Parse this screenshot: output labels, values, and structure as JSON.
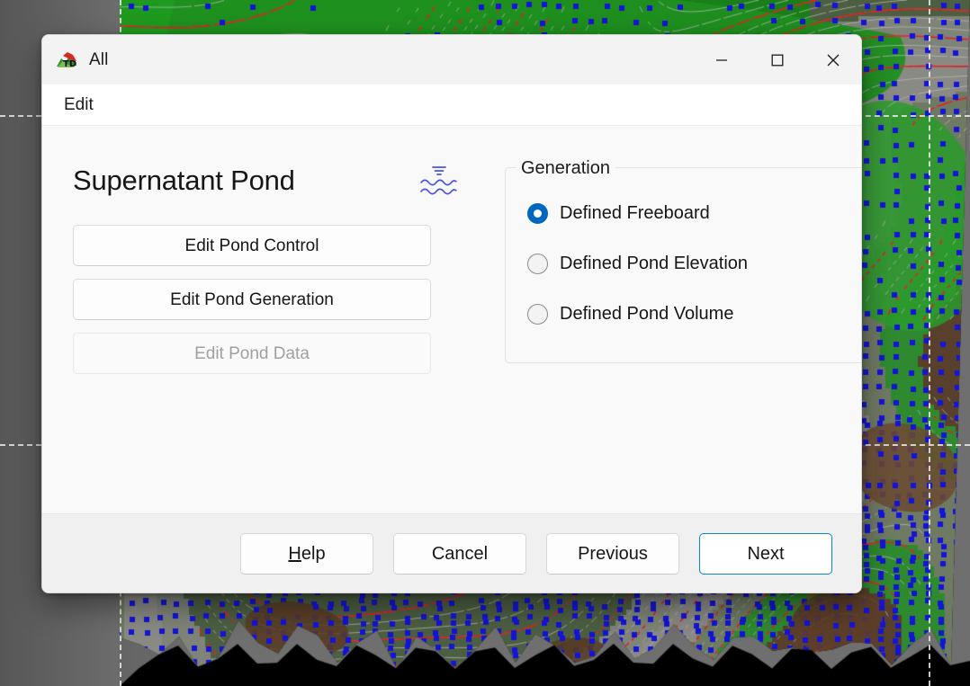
{
  "window": {
    "title": "All",
    "app_icon": "terrain-logo-icon",
    "controls": {
      "minimize": "minimize-icon",
      "maximize": "maximize-icon",
      "close": "close-icon"
    }
  },
  "menubar": {
    "items": [
      {
        "label": "Edit"
      }
    ]
  },
  "page": {
    "heading": "Supernatant Pond",
    "heading_icon": "water-level-icon"
  },
  "actions": [
    {
      "label": "Edit Pond Control",
      "disabled": false
    },
    {
      "label": "Edit Pond Generation",
      "disabled": false
    },
    {
      "label": "Edit Pond Data",
      "disabled": true
    }
  ],
  "generation": {
    "legend": "Generation",
    "options": [
      {
        "label": "Defined Freeboard",
        "selected": true
      },
      {
        "label": "Defined Pond Elevation",
        "selected": false
      },
      {
        "label": "Defined Pond Volume",
        "selected": false
      }
    ]
  },
  "footer": {
    "buttons": [
      {
        "label": "Help",
        "accel": "H",
        "default": false
      },
      {
        "label": "Cancel",
        "accel": "",
        "default": false
      },
      {
        "label": "Previous",
        "accel": "",
        "default": false
      },
      {
        "label": "Next",
        "accel": "",
        "default": true
      }
    ]
  },
  "colors": {
    "accent": "#0067c0",
    "default_button_border": "#0f7fd4",
    "titlebar": "#f3f3f3",
    "dialog_body": "#f9f9f9",
    "footer": "#f0f0f0",
    "desktop": "#6f6f6f",
    "map_contour": "#e02020",
    "map_point": "#1414d8",
    "map_terrain": "#1f8a1f"
  },
  "background": {
    "description": "topographic-survey-map",
    "guides": [
      {
        "orientation": "horizontal",
        "pos": 128
      },
      {
        "orientation": "horizontal",
        "pos": 494
      },
      {
        "orientation": "vertical",
        "pos": 133
      },
      {
        "orientation": "vertical",
        "pos": 1032
      }
    ]
  }
}
